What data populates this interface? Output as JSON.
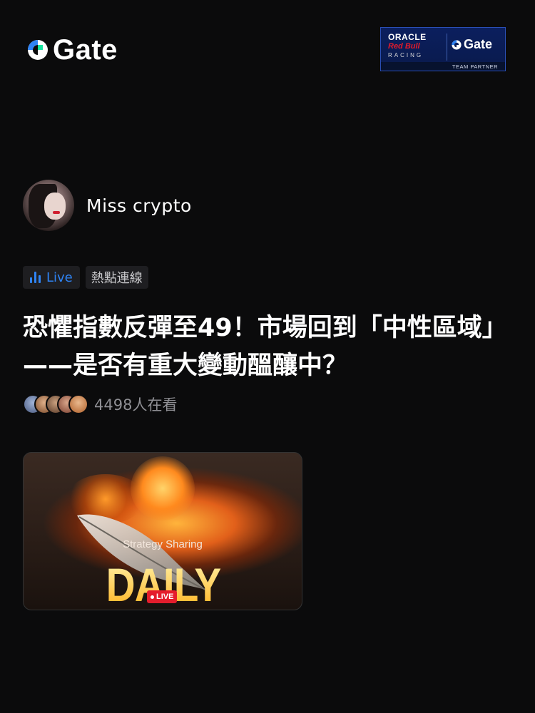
{
  "header": {
    "logo_text": "Gate",
    "logo_icon": "gate-logo-icon",
    "partner": {
      "oracle": "ORACLE",
      "red_bull": "Red Bull",
      "racing": "RACING",
      "gate": "Gate",
      "team_partner": "TEAM PARTNER"
    }
  },
  "author": {
    "name": "Miss crypto"
  },
  "tags": {
    "live": "Live",
    "topic": "熱點連線"
  },
  "post": {
    "title": "恐懼指數反彈至49！市場回到「中性區域」——是否有重大變動醞釀中？",
    "viewers": "4498人在看"
  },
  "thumbnail": {
    "subtitle": "Strategy Sharing",
    "headline": "DAILY REVIEW",
    "live_badge": "LIVE"
  },
  "colors": {
    "background": "#0b0b0c",
    "accent_blue": "#2f84f5",
    "live_red": "#e51d2c",
    "muted_text": "#8f8f94"
  }
}
